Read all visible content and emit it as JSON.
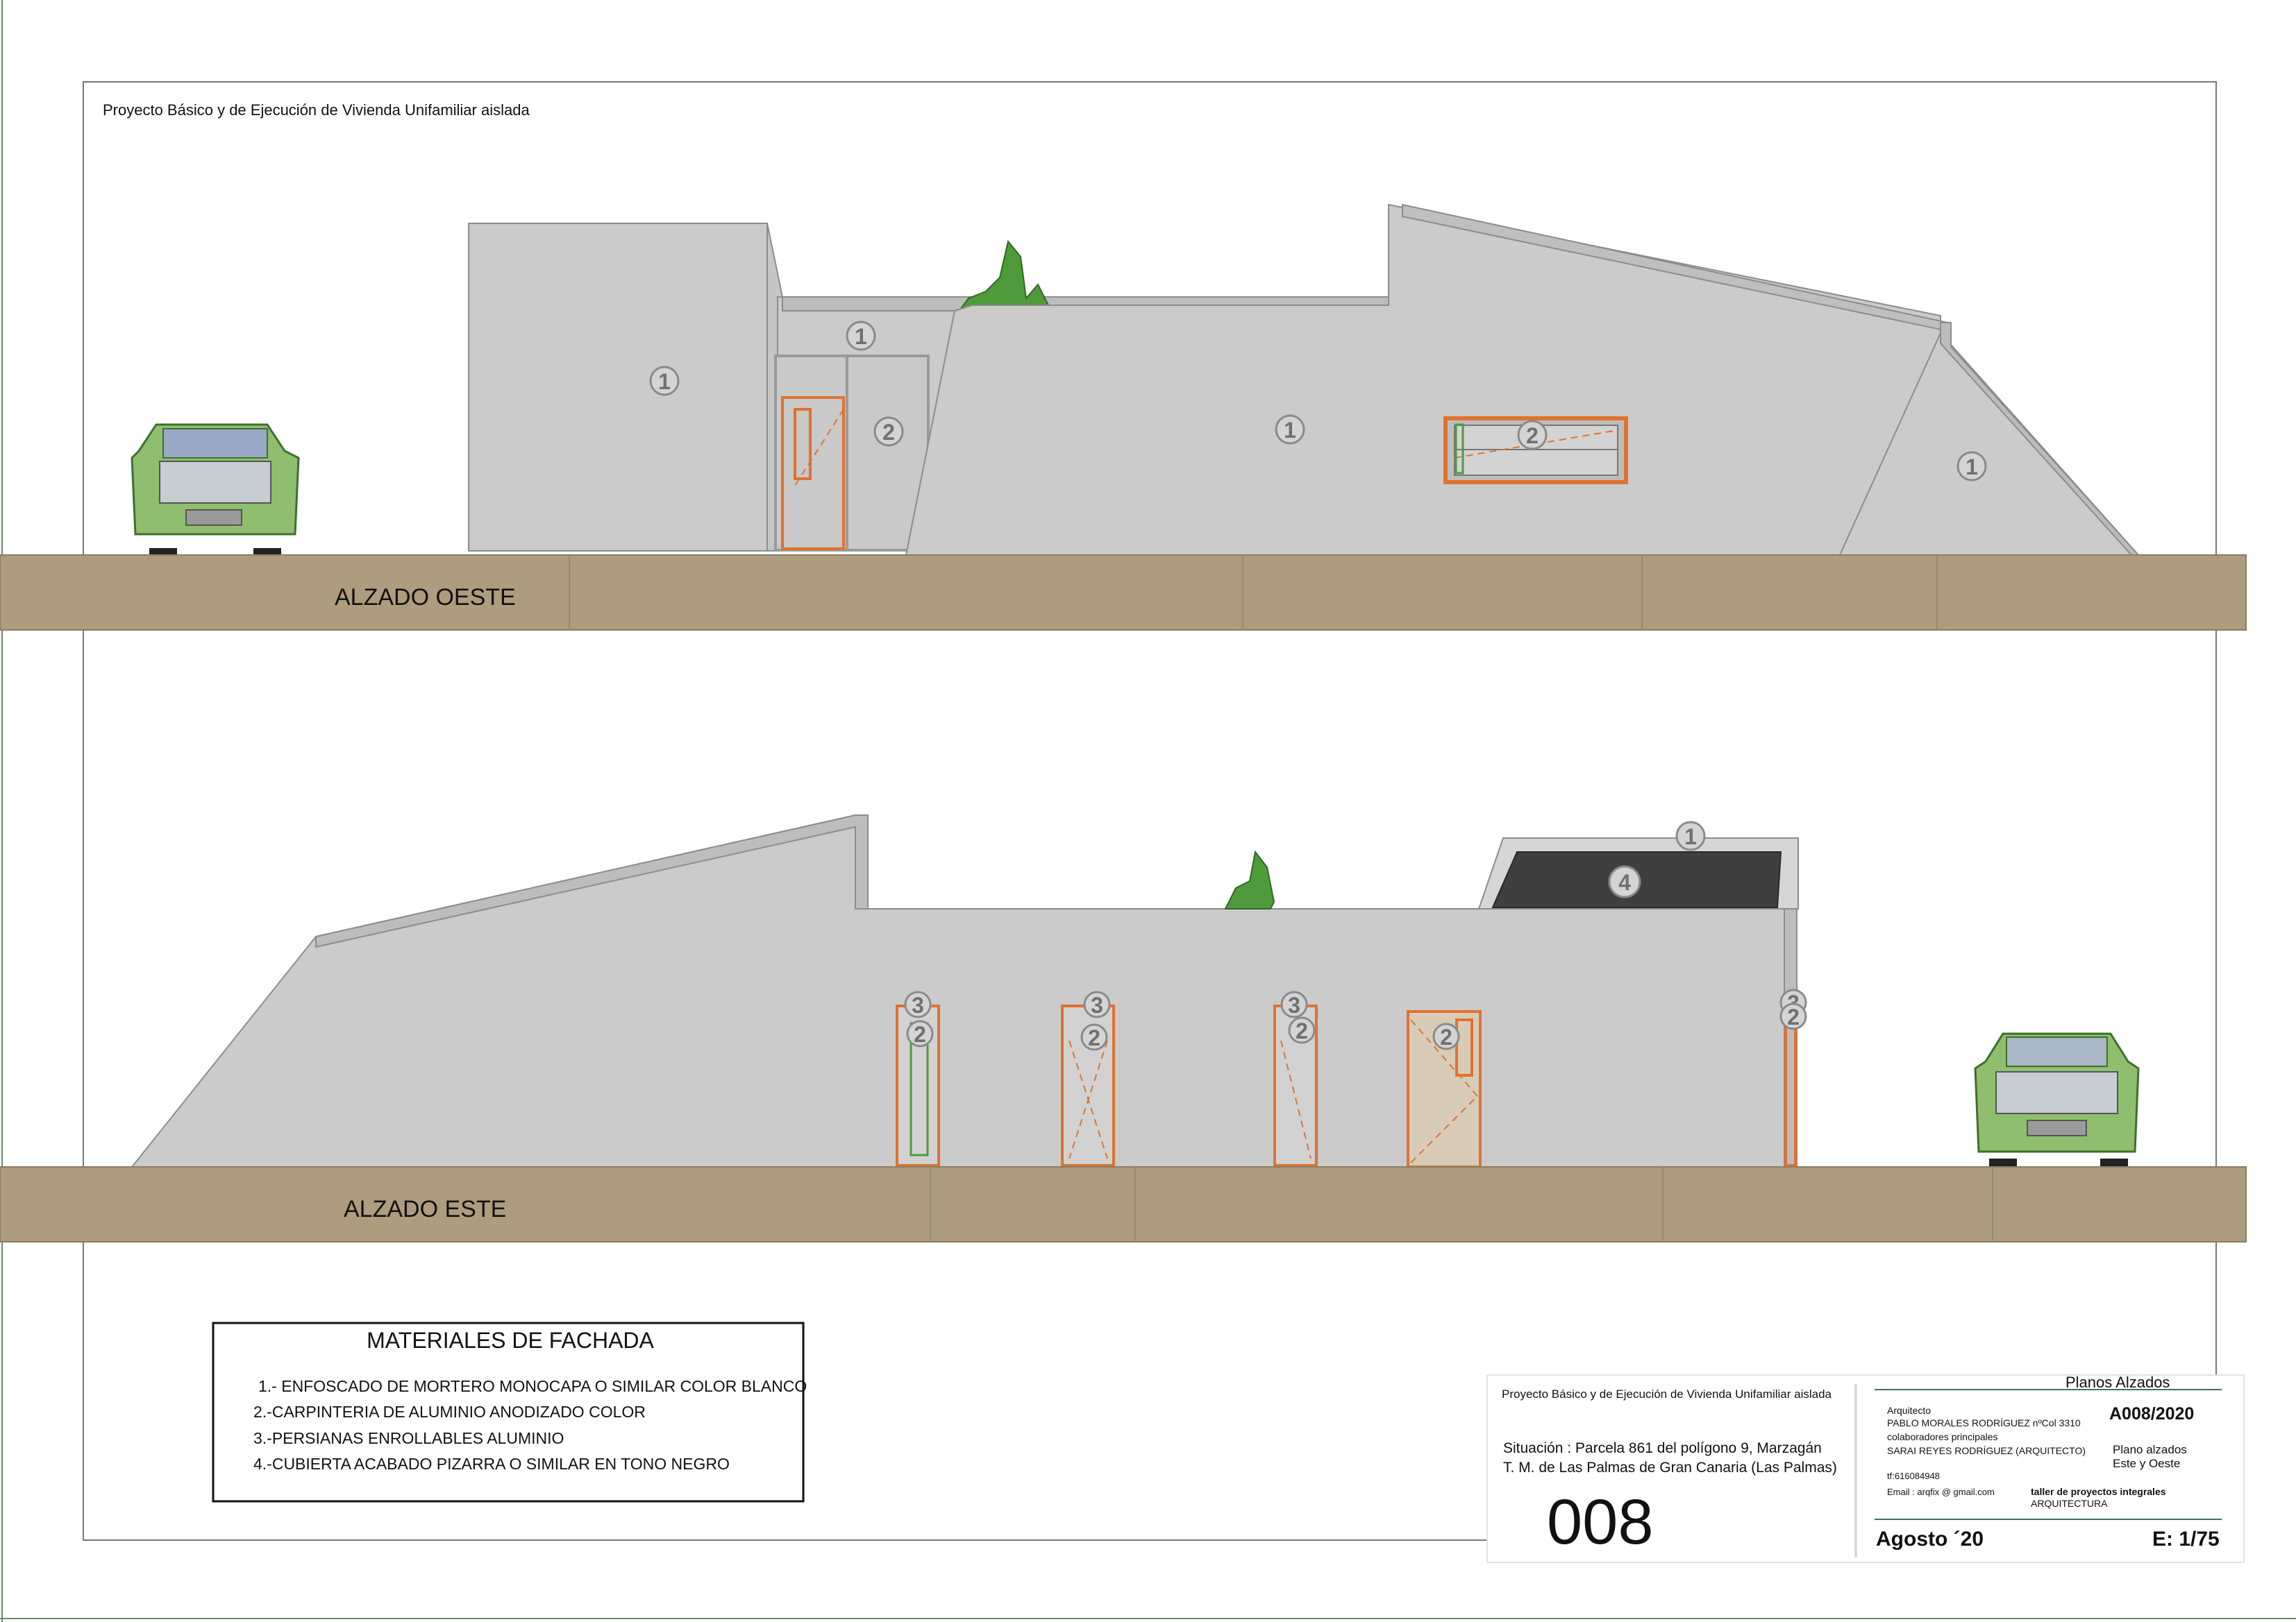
{
  "header": {
    "project_title": "Proyecto Básico y de Ejecución de Vivienda Unifamiliar aislada"
  },
  "elevations": [
    {
      "label": "ALZADO OESTE"
    },
    {
      "label": "ALZADO ESTE"
    }
  ],
  "material_tags": [
    "1",
    "2",
    "3",
    "4"
  ],
  "legend": {
    "title": "MATERIALES DE FACHADA",
    "items": [
      "1.- ENFOSCADO DE MORTERO MONOCAPA O SIMILAR COLOR BLANCO",
      "2.-CARPINTERIA DE ALUMINIO ANODIZADO COLOR",
      "3.-PERSIANAS ENROLLABLES ALUMINIO",
      "4.-CUBIERTA ACABADO PIZARRA O SIMILAR EN TONO NEGRO"
    ]
  },
  "title_block": {
    "project": "Proyecto Básico y de Ejecución de Vivienda Unifamiliar aislada",
    "situation_line1": "Situación : Parcela 861 del polígono 9, Marzagán",
    "situation_line2": "T. M. de Las Palmas de Gran Canaria (Las Palmas)",
    "sheet_number": "008",
    "sheet_type": "Planos Alzados",
    "architect_label": "Arquitecto",
    "architect_name": "PABLO MORALES RODRÍGUEZ nºCol 3310",
    "collaborators_label": "colaboradores principales",
    "collaborator_name": "SARAI REYES RODRÍGUEZ (ARQUITECTO)",
    "phone": "tf:616084948",
    "email": "Email : arqfix @ gmail.com",
    "code": "A008/2020",
    "description_line1": "Plano alzados",
    "description_line2": "Este y Oeste",
    "studio_line1": "taller de proyectos integrales",
    "studio_line2": "ARQUITECTURA",
    "date": "Agosto ´20",
    "scale": "E: 1/75"
  },
  "colors": {
    "ground": "#ad9d7e",
    "wall": "#cbcbcb",
    "roof_dark": "#3f3f3f",
    "window_frame": "#e0722f",
    "accent_green": "#4f9a3a",
    "title_teal": "#3d6f6f"
  }
}
